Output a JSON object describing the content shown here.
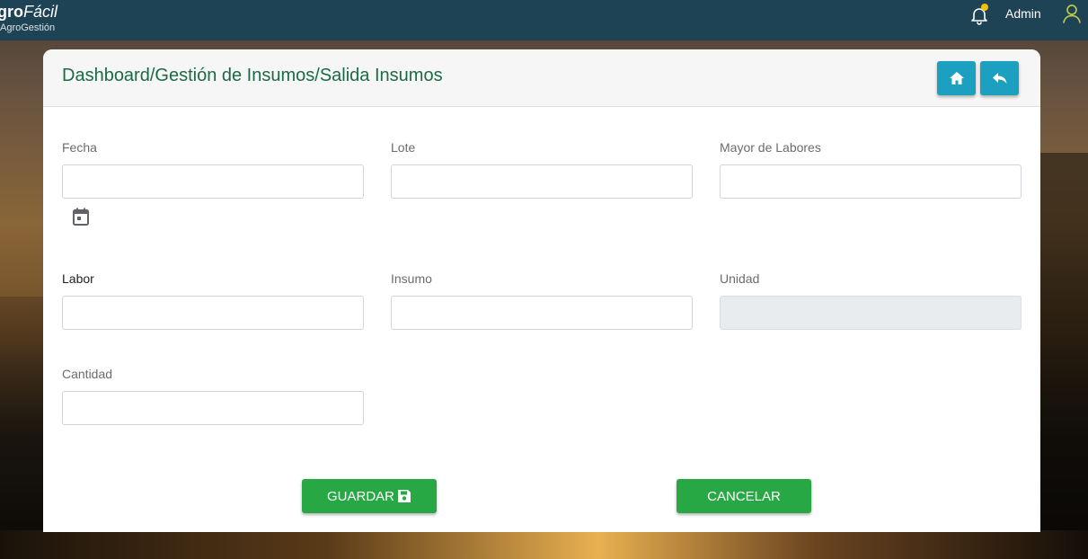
{
  "brand": {
    "name_bold": "gro",
    "name_italic": "Fácil",
    "subtitle": "AgroGestión"
  },
  "topbar": {
    "user_name": "Admin",
    "notification_icon": "bell-icon",
    "user_icon": "user-icon"
  },
  "header": {
    "breadcrumb": "Dashboard/Gestión de Insumos/Salida Insumos",
    "home_icon": "home-icon",
    "back_icon": "reply-icon"
  },
  "form": {
    "fecha": {
      "label": "Fecha",
      "value": ""
    },
    "lote": {
      "label": "Lote",
      "value": ""
    },
    "mayor_labores": {
      "label": "Mayor de Labores",
      "value": ""
    },
    "labor": {
      "label": "Labor",
      "value": ""
    },
    "insumo": {
      "label": "Insumo",
      "value": ""
    },
    "unidad": {
      "label": "Unidad",
      "value": ""
    },
    "cantidad": {
      "label": "Cantidad",
      "value": ""
    }
  },
  "actions": {
    "save_label": "GUARDAR",
    "cancel_label": "CANCELAR"
  },
  "colors": {
    "topbar": "#1e4354",
    "title": "#1a6b45",
    "header_button": "#1ba0bf",
    "action_button": "#28a745",
    "notification_dot": "#f4c20d"
  }
}
